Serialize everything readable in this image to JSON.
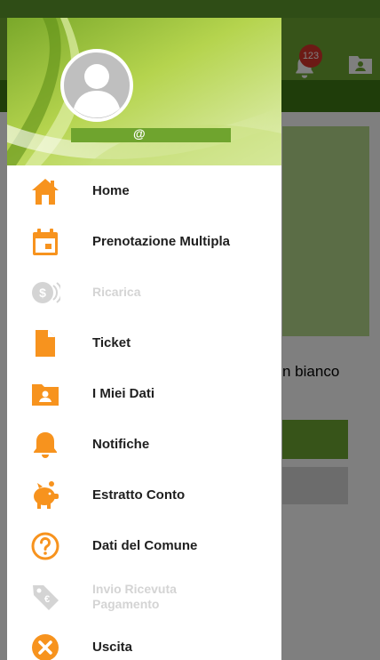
{
  "colors": {
    "accent_orange": "#f7931e",
    "app_green": "#6ea832",
    "disabled_gray": "#d4d4d4"
  },
  "appbar": {
    "notification_badge": "123",
    "bell_icon": "bell-icon",
    "profile_icon": "profile-card-icon"
  },
  "background": {
    "partial_text": "n bianco"
  },
  "drawer": {
    "header": {
      "avatar_icon": "user-avatar-icon",
      "account_at": "@"
    },
    "items": [
      {
        "label": "Home",
        "icon": "home-icon",
        "enabled": true
      },
      {
        "label": "Prenotazione Multipla",
        "icon": "calendar-icon",
        "enabled": true
      },
      {
        "label": "Ricarica",
        "icon": "coin-icon",
        "enabled": false
      },
      {
        "label": "Ticket",
        "icon": "document-icon",
        "enabled": true
      },
      {
        "label": "I Miei Dati",
        "icon": "user-folder-icon",
        "enabled": true
      },
      {
        "label": "Notifiche",
        "icon": "bell-icon",
        "enabled": true
      },
      {
        "label": "Estratto Conto",
        "icon": "piggy-bank-icon",
        "enabled": true
      },
      {
        "label": "Dati del Comune",
        "icon": "help-icon",
        "enabled": true
      },
      {
        "label": "Invio Ricevuta\nPagamento",
        "icon": "price-tag-icon",
        "enabled": false
      },
      {
        "label": "Uscita",
        "icon": "close-circle-icon",
        "enabled": true
      }
    ]
  }
}
